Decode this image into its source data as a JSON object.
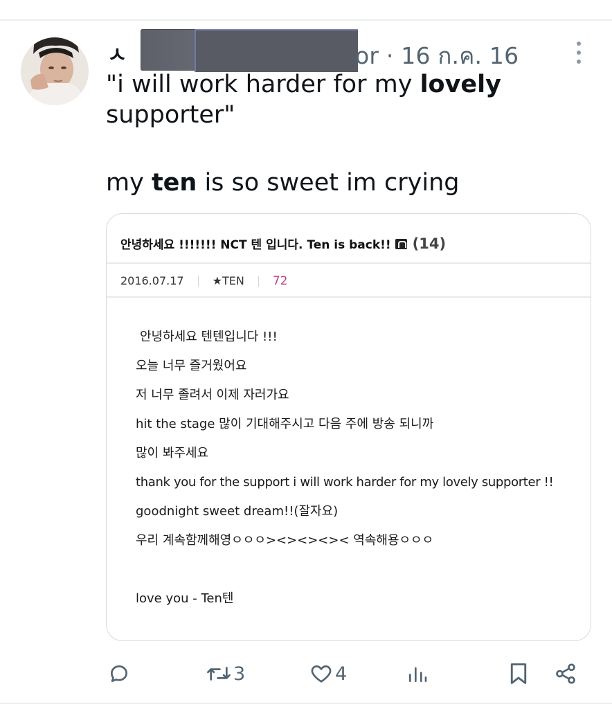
{
  "tweet": {
    "author_initial": "ㅅ",
    "handle_tail": "or",
    "dot": "·",
    "date": "16 ก.ค. 16",
    "text_line1_pre": "\"i will work harder for my ",
    "text_line1_bold": "lovely",
    "text_line2": "supporter\"",
    "text_line3_pre": "my ",
    "text_line3_bold": "ten",
    "text_line3_post": " is so sweet im crying"
  },
  "embedded_post": {
    "title": "안녕하세요 !!!!!!! NCT 텐 입니다. Ten is back!!",
    "comment_count": "(14)",
    "date": "2016.07.17",
    "author": "★TEN",
    "views": "72",
    "lines": [
      "안녕하세요 텐텐입니다 !!!",
      "오늘 너무 즐거웠어요",
      "저 너무 졸려서 이제 자러가요",
      "hit the stage 많이 기대해주시고 다음 주에 방송 되니까",
      "많이 봐주세요",
      "thank you for the support i will work harder for my lovely supporter !!",
      "goodnight sweet dream!!(잘자요)",
      "우리 계속함께해영ㅇㅇㅇ><><><>< 역속해용ㅇㅇㅇ",
      "",
      "love you - Ten텐"
    ]
  },
  "actions": {
    "reply_icon": "reply-icon",
    "retweet_icon": "retweet-icon",
    "retweet_count": "3",
    "like_icon": "heart-icon",
    "like_count": "4",
    "views_icon": "bar-chart-icon",
    "bookmark_icon": "bookmark-icon",
    "share_icon": "share-icon"
  },
  "colors": {
    "text": "#0f1419",
    "secondary": "#536471",
    "border": "#d3dce3",
    "accent_pink": "#cc3c82"
  }
}
